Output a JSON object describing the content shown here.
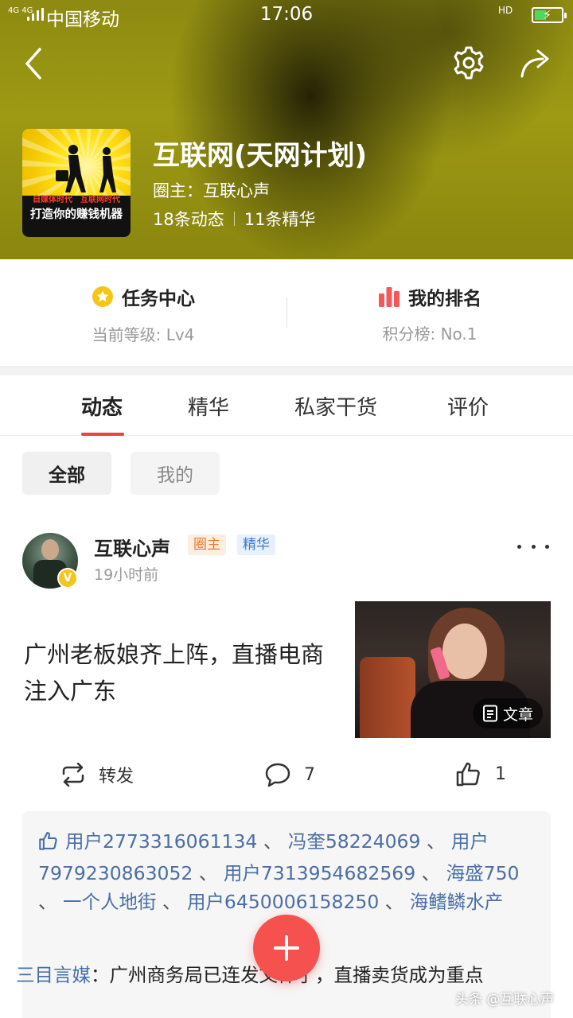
{
  "status_bar": {
    "network": "4G 4G",
    "carrier": "中国移动",
    "time": "17:06",
    "hd": "HD"
  },
  "group": {
    "title": "互联网(天网计划)",
    "owner_line": "圈主：互联心声",
    "posts_count": "18条动态",
    "essence_count": "11条精华",
    "cover_text_top": "自媒体时代　互联网时代",
    "cover_text_main": "打造你的赚钱机器"
  },
  "info": {
    "task": {
      "title": "任务中心",
      "sub": "当前等级: Lv4",
      "icon": "star-icon",
      "color": "#f5c518"
    },
    "rank": {
      "title": "我的排名",
      "sub": "积分榜: No.1",
      "icon": "bar-chart-icon",
      "color": "#f25a5a"
    }
  },
  "tabs": [
    {
      "label": "动态",
      "active": true
    },
    {
      "label": "精华",
      "active": false
    },
    {
      "label": "私家干货",
      "active": false
    },
    {
      "label": "评价",
      "active": false
    }
  ],
  "filters": {
    "all": "全部",
    "mine": "我的"
  },
  "post": {
    "author": "互联心声",
    "badge_owner": "圈主",
    "badge_essence": "精华",
    "time": "19小时前",
    "verified": "V",
    "text": "广州老板娘齐上阵，直播电商注入广东",
    "thumb_tag": "文章",
    "actions": {
      "repost": "转发",
      "comments": "7",
      "likes": "1"
    }
  },
  "likes_list": {
    "users": [
      "用户2773316061134",
      "冯奎58224069",
      "用户7979230863052",
      "用户7313954682569",
      "海盛750",
      "一个人地街",
      "用户6450006158250",
      "海鳍鳞水产"
    ],
    "delimiter": " 、 "
  },
  "comment": {
    "author": "三目言媒",
    "text": "：广州商务局已连发文件了，直播卖货成为重点"
  },
  "watermark": "头条 @互联心声",
  "colors": {
    "accent": "#f04142",
    "link": "#4a6fa5",
    "fab": "#f5524f",
    "header": "#8e8a12"
  }
}
